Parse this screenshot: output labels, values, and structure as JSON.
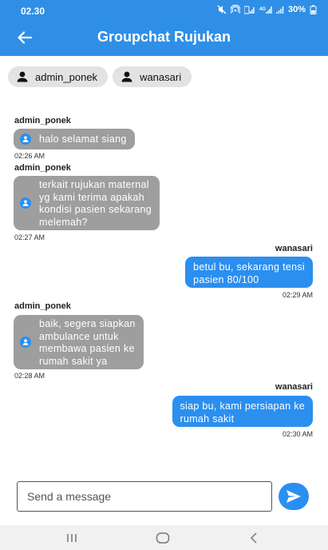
{
  "status_bar": {
    "time": "02.30",
    "battery": "30%"
  },
  "app_bar": {
    "title": "Groupchat Rujukan",
    "back_icon": "arrow-left-icon"
  },
  "members": [
    {
      "name": "admin_ponek",
      "icon": "person-icon"
    },
    {
      "name": "wanasari",
      "icon": "person-icon"
    }
  ],
  "messages": [
    {
      "sender": "admin_ponek",
      "direction": "in",
      "text": "halo selamat siang",
      "time": "02:26 AM"
    },
    {
      "sender": "admin_ponek",
      "direction": "in",
      "text": "terkait rujukan maternal\nyg kami terima apakah\nkondisi pasien sekarang\nmelemah?",
      "time": "02:27 AM"
    },
    {
      "sender": "wanasari",
      "direction": "out",
      "text": "betul bu, sekarang tensi\npasien 80/100",
      "time": "02:29 AM"
    },
    {
      "sender": "admin_ponek",
      "direction": "in",
      "text": "baik, segera siapkan\nambulance untuk\nmembawa pasien ke\nrumah sakit ya",
      "time": "02:28 AM"
    },
    {
      "sender": "wanasari",
      "direction": "out",
      "text": "siap bu, kami persiapan ke\nrumah sakit",
      "time": "02:30 AM"
    }
  ],
  "composer": {
    "placeholder": "Send a message",
    "value": "",
    "send_icon": "send-icon"
  },
  "nav_bar": {
    "recents_icon": "recents-icon",
    "home_icon": "home-icon",
    "back_icon": "nav-back-icon"
  },
  "colors": {
    "primary": "#2f8fe7",
    "bubble_out": "#2b8ff0",
    "bubble_in": "#9e9e9e",
    "chip_bg": "#e3e3e3"
  }
}
